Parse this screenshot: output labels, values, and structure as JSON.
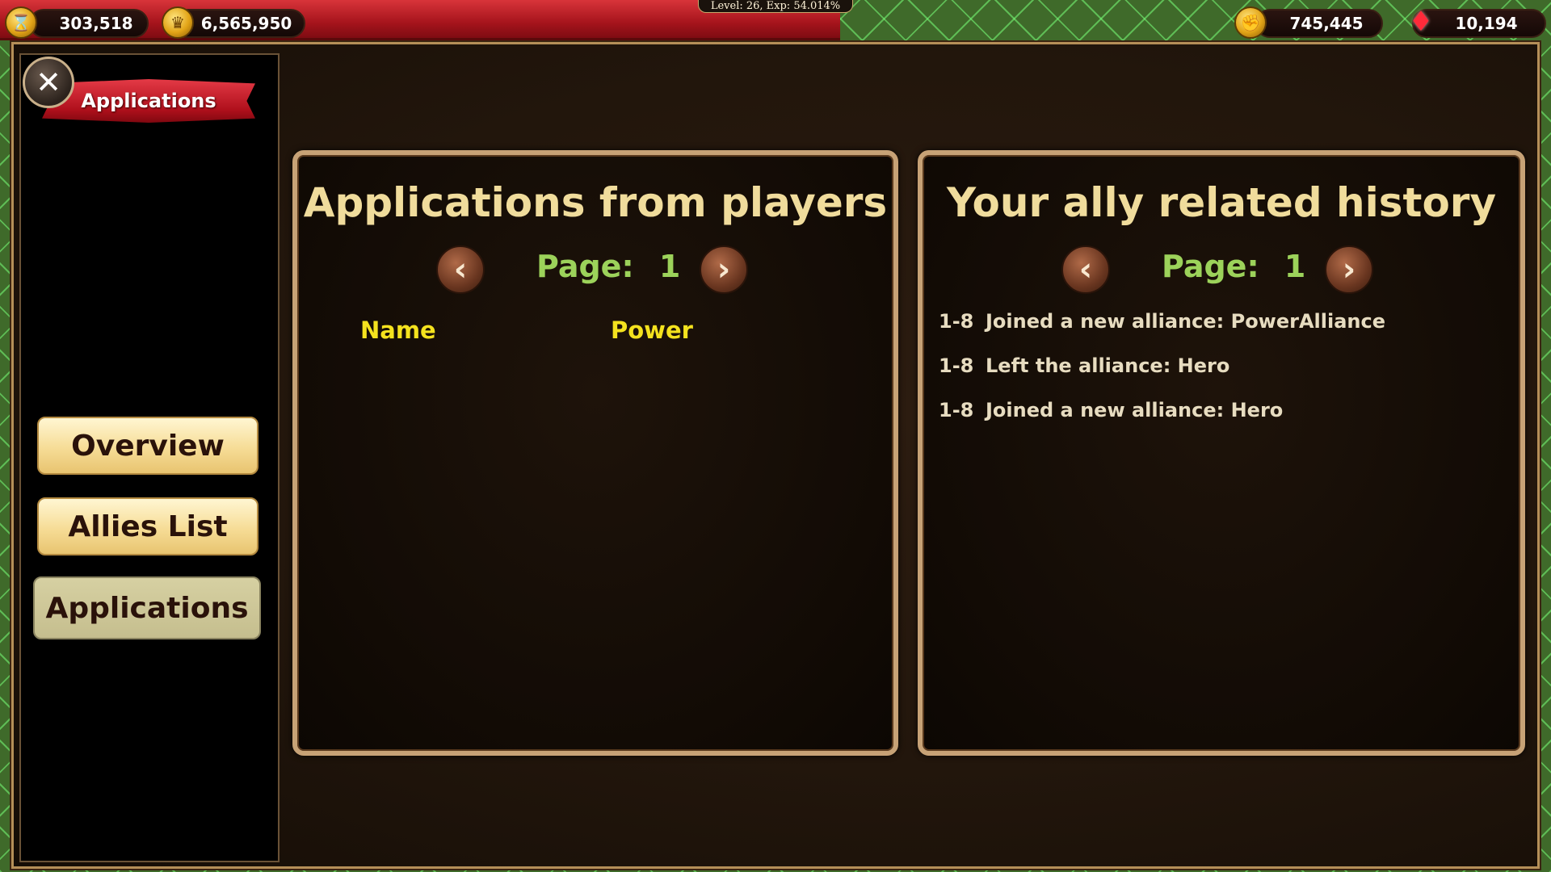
{
  "topbar": {
    "hourglass_icon": "hourglass-coin-icon",
    "resource_1": "303,518",
    "crown_icon": "crown-coin-icon",
    "resource_2": "6,565,950",
    "level_text": "Level: 26, Exp: 54.014%",
    "fist_icon": "fist-coin-icon",
    "resource_3": "745,445",
    "gem_icon": "ruby-gem-icon",
    "resource_4": "10,194"
  },
  "sidebar": {
    "close_icon": "close-icon",
    "ribbon_title": "Applications",
    "buttons": [
      {
        "label": "Overview",
        "active": false
      },
      {
        "label": "Allies List",
        "active": false
      },
      {
        "label": "Applications",
        "active": true
      }
    ]
  },
  "applications_panel": {
    "title": "Applications from players",
    "page_label": "Page:",
    "page_number": "1",
    "columns": [
      "Name",
      "Power"
    ],
    "rows": []
  },
  "history_panel": {
    "title": "Your ally related history",
    "page_label": "Page:",
    "page_number": "1",
    "entries": [
      {
        "date": "1-8",
        "text": "Joined a new alliance: PowerAlliance"
      },
      {
        "date": "1-8",
        "text": "Left the alliance: Hero"
      },
      {
        "date": "1-8",
        "text": "Joined a new alliance: Hero"
      }
    ]
  },
  "colors": {
    "title": "#f0dc9c",
    "page_text": "#9cd25a",
    "column_header": "#f4e21e",
    "history_text": "#e7dcc0",
    "ribbon_red": "#c8202c",
    "button_cream": "#f6dc96"
  }
}
